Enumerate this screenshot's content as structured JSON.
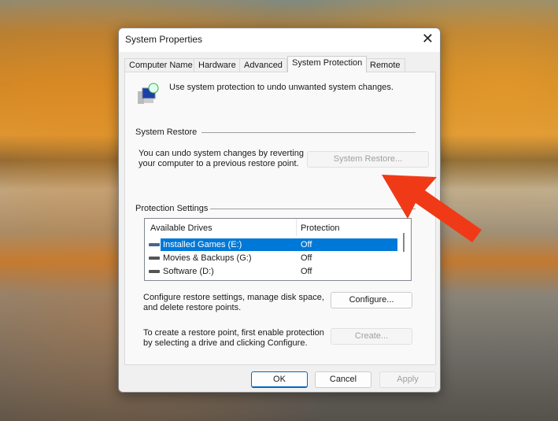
{
  "window": {
    "title": "System Properties",
    "close_icon": "close-icon"
  },
  "tabs": [
    {
      "label": "Computer Name"
    },
    {
      "label": "Hardware"
    },
    {
      "label": "Advanced"
    },
    {
      "label": "System Protection",
      "active": true
    },
    {
      "label": "Remote"
    }
  ],
  "intro": "Use system protection to undo unwanted system changes.",
  "restore": {
    "heading": "System Restore",
    "text1": "You can undo system changes by reverting",
    "text2": "your computer to a previous restore point.",
    "button": "System Restore..."
  },
  "protection": {
    "heading": "Protection Settings",
    "columns": [
      "Available Drives",
      "Protection"
    ],
    "drives": [
      {
        "name": "Installed Games (E:)",
        "protection": "Off",
        "selected": true
      },
      {
        "name": "Movies & Backups (G:)",
        "protection": "Off"
      },
      {
        "name": "Software (D:)",
        "protection": "Off"
      }
    ],
    "configure_text1": "Configure restore settings, manage disk space,",
    "configure_text2": "and delete restore points.",
    "configure_button": "Configure...",
    "create_text1": "To create a restore point, first enable protection",
    "create_text2": "by selecting a drive and clicking Configure.",
    "create_button": "Create..."
  },
  "footer": {
    "ok": "OK",
    "cancel": "Cancel",
    "apply": "Apply"
  },
  "colors": {
    "selection": "#0078d7",
    "arrow": "#f03a17"
  }
}
